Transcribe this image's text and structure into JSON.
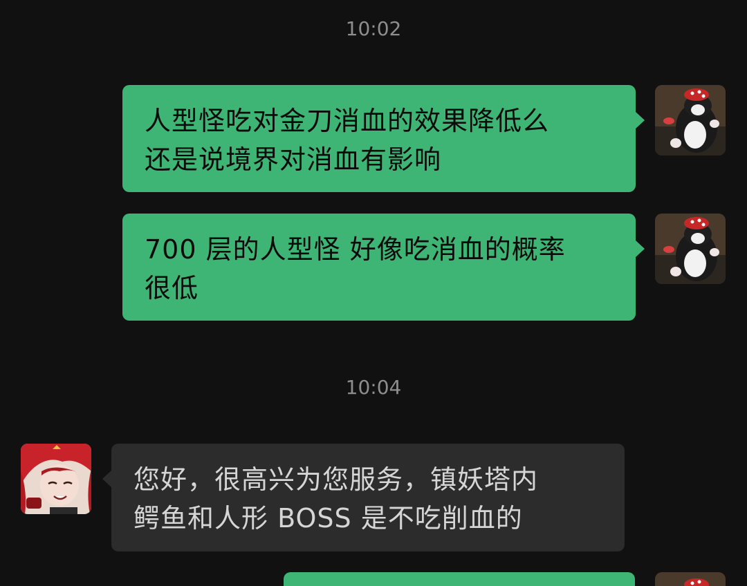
{
  "conversation": {
    "timestamps": [
      "10:02",
      "10:04"
    ],
    "messages": [
      {
        "sender": "self",
        "lines": [
          "人型怪吃对金刀消血的效果降低么",
          "还是说境界对消血有影响"
        ]
      },
      {
        "sender": "self",
        "lines": [
          "700 层的人型怪  好像吃消血的概率",
          "很低"
        ]
      },
      {
        "sender": "other",
        "lines": [
          "您好，很高兴为您服务，镇妖塔内",
          "鳄鱼和人形 BOSS 是不吃削血的"
        ]
      },
      {
        "sender": "self",
        "lines": []
      }
    ]
  },
  "colors": {
    "background": "#111111",
    "outgoing_bubble": "#3eb575",
    "incoming_bubble": "#2c2c2c",
    "timestamp_text": "#8e8e8e"
  },
  "icons": {
    "self_avatar": "cat-avatar-icon",
    "other_avatar": "anime-character-avatar-icon"
  }
}
